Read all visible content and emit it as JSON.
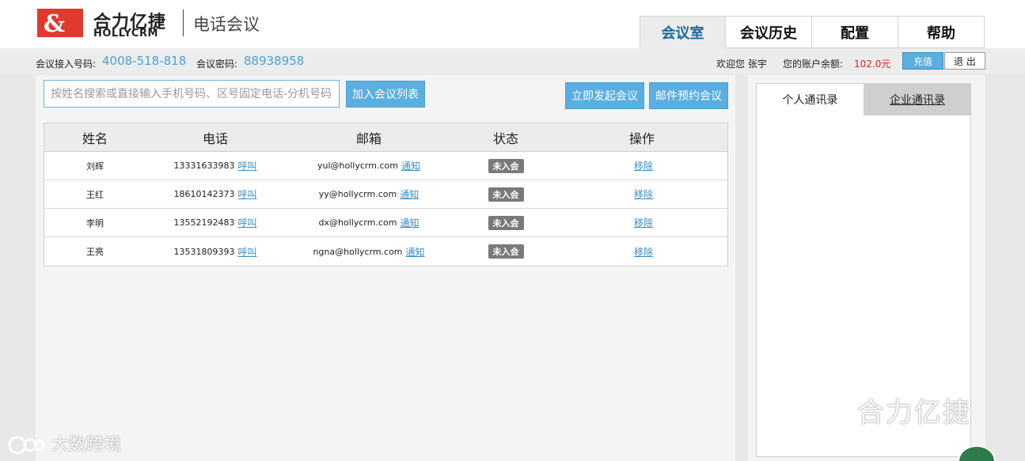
{
  "brand": {
    "logo_mark": "&",
    "name_cn": "合力亿捷",
    "name_en": "HOLLYCRM",
    "product": "电话会议"
  },
  "nav": {
    "tabs": [
      {
        "label": "会议室",
        "active": true
      },
      {
        "label": "会议历史",
        "active": false
      },
      {
        "label": "配置",
        "active": false
      },
      {
        "label": "帮助",
        "active": false
      }
    ]
  },
  "info": {
    "access_label": "会议接入号码:",
    "access_number": "4008-518-818",
    "password_label": "会议密码:",
    "password": "88938958",
    "welcome": "欢迎您 张宇",
    "balance_label": "您的账户余额:",
    "balance": "102.0元",
    "recharge": "充值",
    "logout": "退 出"
  },
  "search": {
    "placeholder": "按姓名搜索或直接输入手机号码、区号固定电话-分机号码"
  },
  "buttons": {
    "add_to_list": "加入会议列表",
    "start_now": "立即发起会议",
    "email_schedule": "邮件预约会议"
  },
  "table": {
    "headers": [
      "姓名",
      "电话",
      "邮箱",
      "状态",
      "操作"
    ],
    "call_label": "呼叫",
    "notify_label": "通知",
    "remove_label": "移除",
    "rows": [
      {
        "name": "刘辉",
        "phone": "13331633983",
        "email": "yul@hollycrm.com",
        "status": "未入会"
      },
      {
        "name": "王红",
        "phone": "18610142373",
        "email": "yy@hollycrm.com",
        "status": "未入会"
      },
      {
        "name": "李明",
        "phone": "13552192483",
        "email": "dx@hollycrm.com",
        "status": "未入会"
      },
      {
        "name": "王亮",
        "phone": "13531809393",
        "email": "ngna@hollycrm.com",
        "status": "未入会"
      }
    ]
  },
  "contacts": {
    "tabs": [
      {
        "label": "个人通讯录",
        "active": true
      },
      {
        "label": "企业通讯录",
        "active": false
      }
    ]
  },
  "watermarks": {
    "right": "合力亿捷",
    "left": "大数跨境"
  },
  "colors": {
    "brand_red": "#e03a2e",
    "accent_blue": "#5aaee0",
    "balance_red": "#e02020"
  }
}
